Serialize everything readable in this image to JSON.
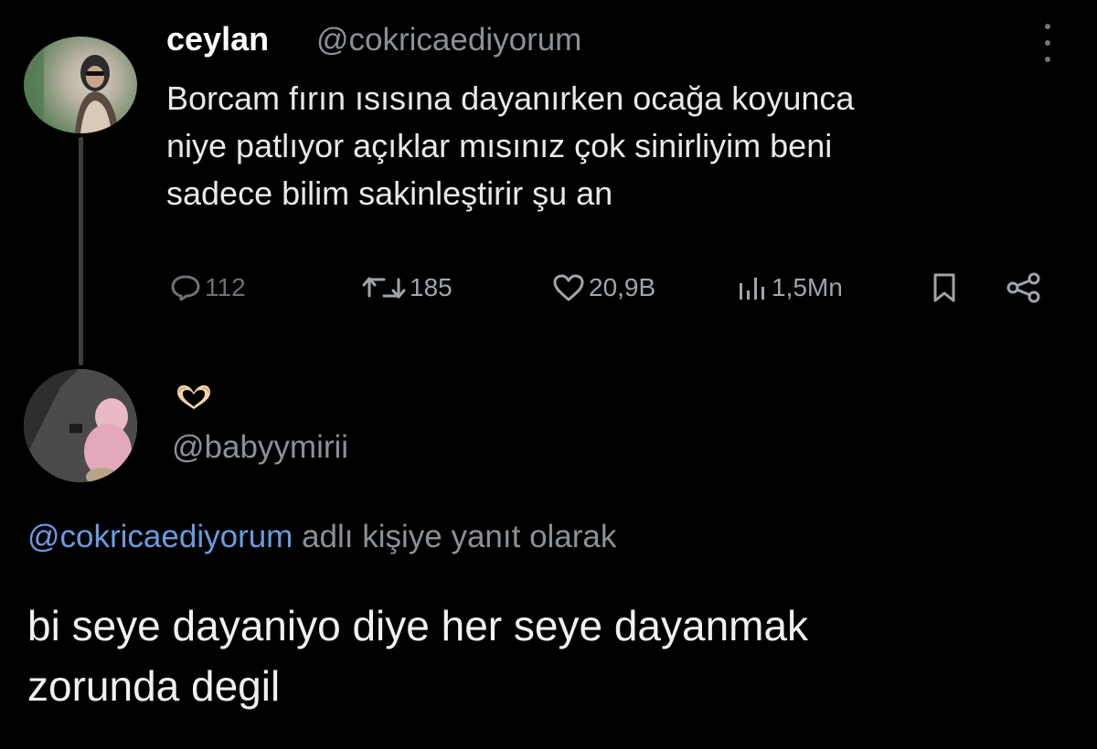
{
  "tweet": {
    "author_name": "ceylan",
    "author_handle": "@cokricaediyorum",
    "text_lines": [
      "Borcam fırın ısısına dayanırken ocağa koyunca",
      "niye patlıyor açıklar mısınız çok sinirliyim beni",
      "sadece bilim sakinleştirir şu an"
    ],
    "actions": {
      "replies": "112",
      "retweets": "185",
      "likes": "20,9B",
      "views": "1,5Mn"
    },
    "icons": {
      "more": "more-vertical-icon",
      "reply": "comment-bubble-icon",
      "retweet": "retweet-icon",
      "like": "heart-icon",
      "views": "bar-chart-icon",
      "bookmark": "bookmark-icon",
      "share": "share-icon"
    }
  },
  "reply": {
    "display_name_emoji": "heart-hands-emoji",
    "author_handle": "@babyymirii",
    "context_mention": "@cokricaediyorum",
    "context_text": " adlı kişiye yanıt olarak",
    "text_lines": [
      "bi seye dayaniyo diye her seye dayanmak",
      "zorunda degil"
    ]
  },
  "colors": {
    "background": "#000000",
    "text_primary": "#e7e9ea",
    "text_secondary": "#8b9096",
    "mention": "#6a9be0"
  }
}
